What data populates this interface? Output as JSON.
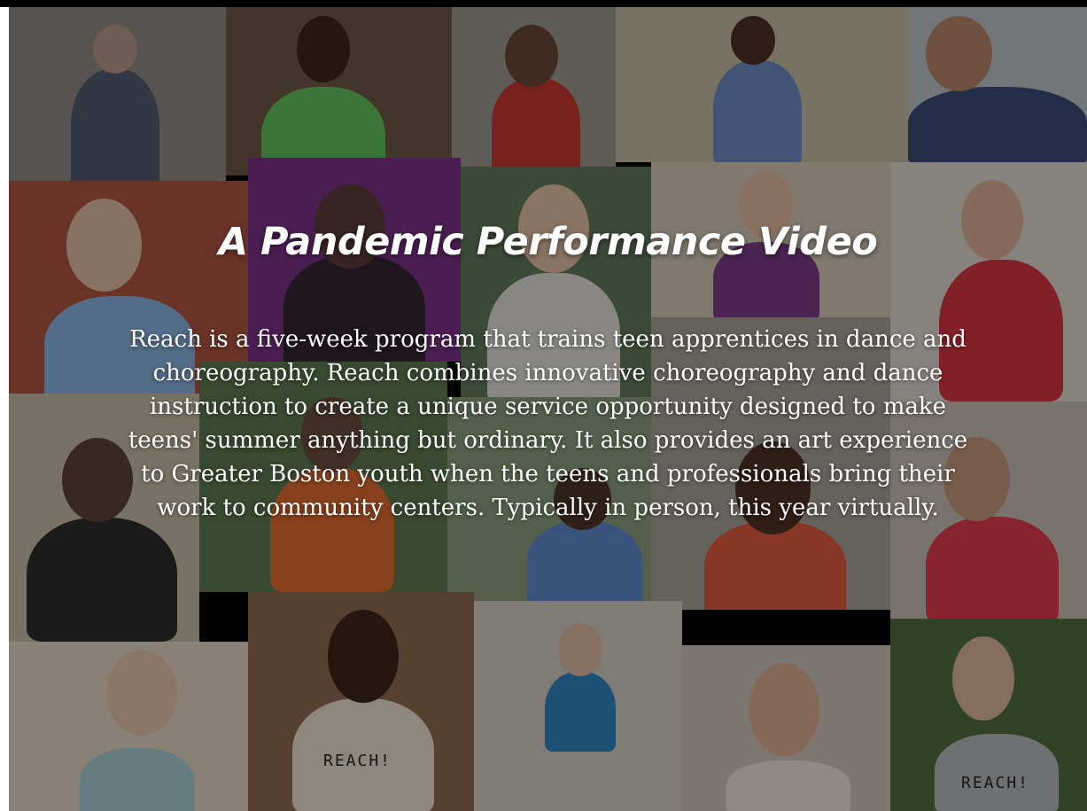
{
  "video": {
    "title": "A Pandemic Performance Video",
    "description_lines": [
      "Reach is a five-week program that trains teen apprentices in dance and",
      "choreography. Reach combines innovative choreography and dance",
      "instruction to create a unique service opportunity designed to make",
      "teens' summer anything but ordinary. It also provides an art experience",
      "to Greater Boston youth when the teens and professionals bring their",
      "work to community centers. Typically in person, this year virtually."
    ],
    "shirt_text": "REACH!"
  },
  "colors": {
    "overlay": "#0a0806",
    "title": "#ffffff",
    "text": "#ffffff"
  }
}
